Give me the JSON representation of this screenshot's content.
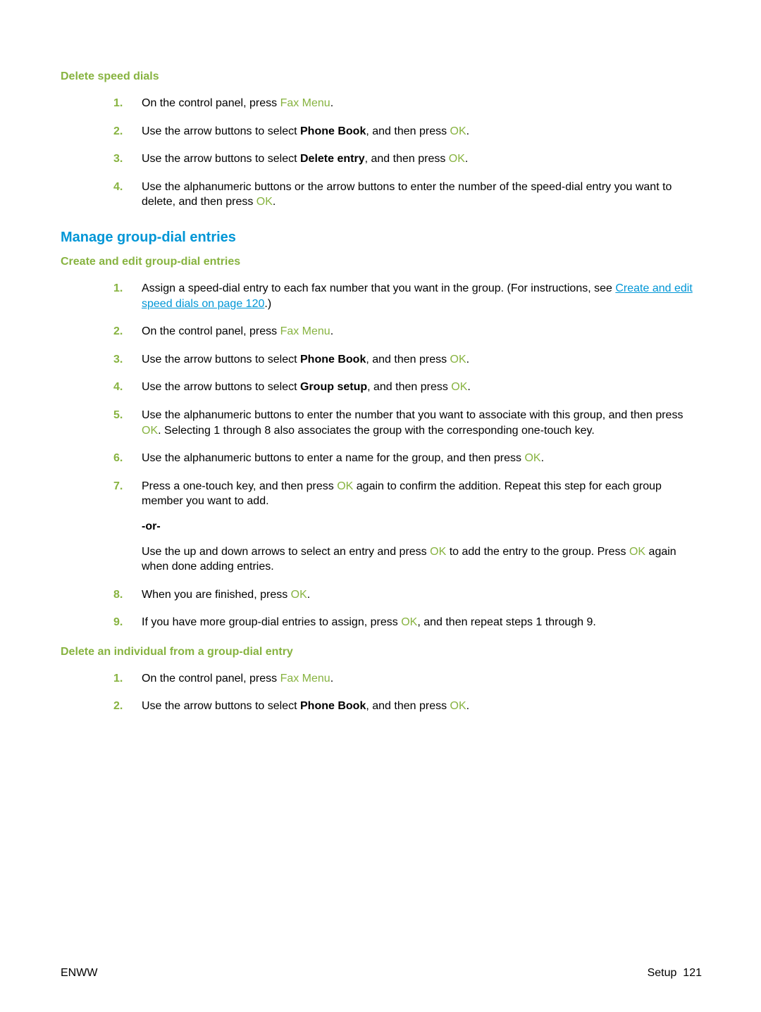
{
  "section1": {
    "title": "Delete speed dials",
    "steps": [
      {
        "num": "1.",
        "plain_a": "On the control panel, press ",
        "key1": "Fax Menu",
        "plain_b": "."
      },
      {
        "num": "2.",
        "plain_a": "Use the arrow buttons to select ",
        "bold1": "Phone Book",
        "plain_b": ", and then press ",
        "key1": "OK",
        "plain_c": "."
      },
      {
        "num": "3.",
        "plain_a": "Use the arrow buttons to select ",
        "bold1": "Delete entry",
        "plain_b": ", and then press ",
        "key1": "OK",
        "plain_c": "."
      },
      {
        "num": "4.",
        "plain_a": "Use the alphanumeric buttons or the arrow buttons to enter the number of the speed-dial entry you want to delete, and then press ",
        "key1": "OK",
        "plain_b": "."
      }
    ]
  },
  "section2": {
    "title": "Manage group-dial entries",
    "sub1": {
      "title": "Create and edit group-dial entries",
      "steps": [
        {
          "num": "1.",
          "plain_a": "Assign a speed-dial entry to each fax number that you want in the group. (For instructions, see ",
          "link": "Create and edit speed dials on page 120",
          "plain_b": ".)"
        },
        {
          "num": "2.",
          "plain_a": "On the control panel, press ",
          "key1": "Fax Menu",
          "plain_b": "."
        },
        {
          "num": "3.",
          "plain_a": "Use the arrow buttons to select ",
          "bold1": "Phone Book",
          "plain_b": ", and then press ",
          "key1": "OK",
          "plain_c": "."
        },
        {
          "num": "4.",
          "plain_a": "Use the arrow buttons to select ",
          "bold1": "Group setup",
          "plain_b": ", and then press ",
          "key1": "OK",
          "plain_c": "."
        },
        {
          "num": "5.",
          "plain_a": "Use the alphanumeric buttons to enter the number that you want to associate with this group, and then press ",
          "key1": "OK",
          "plain_b": ". Selecting 1 through 8 also associates the group with the corresponding one-touch key."
        },
        {
          "num": "6.",
          "plain_a": "Use the alphanumeric buttons to enter a name for the group, and then press ",
          "key1": "OK",
          "plain_b": "."
        },
        {
          "num": "7.",
          "plain_a": "Press a one-touch key, and then press ",
          "key1": "OK",
          "plain_b": " again to confirm the addition. Repeat this step for each group member you want to add.",
          "or": "-or-",
          "plain_c": "Use the up and down arrows to select an entry and press ",
          "key2": "OK",
          "plain_d": " to add the entry to the group. Press ",
          "key3": "OK",
          "plain_e": " again when done adding entries."
        },
        {
          "num": "8.",
          "plain_a": "When you are finished, press ",
          "key1": "OK",
          "plain_b": "."
        },
        {
          "num": "9.",
          "plain_a": "If you have more group-dial entries to assign, press ",
          "key1": "OK",
          "plain_b": ", and then repeat steps 1 through 9."
        }
      ]
    },
    "sub2": {
      "title": "Delete an individual from a group-dial entry",
      "steps": [
        {
          "num": "1.",
          "plain_a": "On the control panel, press ",
          "key1": "Fax Menu",
          "plain_b": "."
        },
        {
          "num": "2.",
          "plain_a": "Use the arrow buttons to select ",
          "bold1": "Phone Book",
          "plain_b": ", and then press ",
          "key1": "OK",
          "plain_c": "."
        }
      ]
    }
  },
  "footer": {
    "left": "ENWW",
    "right_label": "Setup",
    "page_number": "121"
  }
}
